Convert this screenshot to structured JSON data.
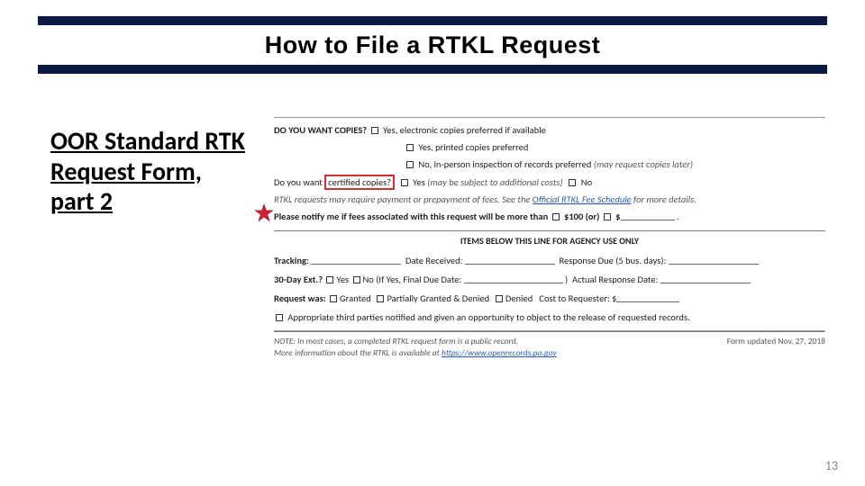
{
  "title": "How to File a RTKL Request",
  "subtitle": "OOR Standard RTK Request Form, part 2",
  "page_number": "13",
  "form": {
    "copies_q": "DO YOU WANT COPIES?",
    "copies_opts": [
      "Yes, electronic copies preferred if available",
      "Yes, printed copies preferred",
      "No, in-person inspection of records preferred"
    ],
    "copies_opt3_note": "(may request copies later)",
    "certified_q_pre": "Do you want",
    "certified_q_box": "certified copies?",
    "certified_yes": "Yes",
    "certified_yes_note": "(may be subject to additional costs)",
    "certified_no": "No",
    "fees_line_pre": "RTKL requests may require payment or prepayment of fees. See the ",
    "fees_link": "Official RTKL Fee Schedule",
    "fees_line_post": " for more details.",
    "notify_line_pre": "Please notify me if fees associated with this request will be more than",
    "notify_opt1": "$100 (or)",
    "notify_opt2": "$",
    "agency_header": "ITEMS BELOW THIS LINE FOR AGENCY USE ONLY",
    "tracking_label": "Tracking:",
    "date_received_label": "Date Received:",
    "response_due_label": "Response Due (5 bus. days):",
    "ext_label": "30-Day Ext.?",
    "yes": "Yes",
    "no": "No",
    "ext_note": "(If Yes, Final Due Date:",
    "actual_label": "Actual Response Date:",
    "reqwas_label": "Request was:",
    "granted": "Granted",
    "partial": "Partially Granted & Denied",
    "denied": "Denied",
    "cost_label": "Cost to Requester: $",
    "third_parties": "Appropriate third parties notified and given an opportunity to object to the release of requested records.",
    "note_line1": "NOTE: In most cases, a completed RTKL request form is a public record.",
    "note_line2_pre": "More information about the RTKL is available at ",
    "note_link": "https://www.openrecords.pa.gov",
    "form_updated": "Form updated Nov. 27, 2018"
  }
}
